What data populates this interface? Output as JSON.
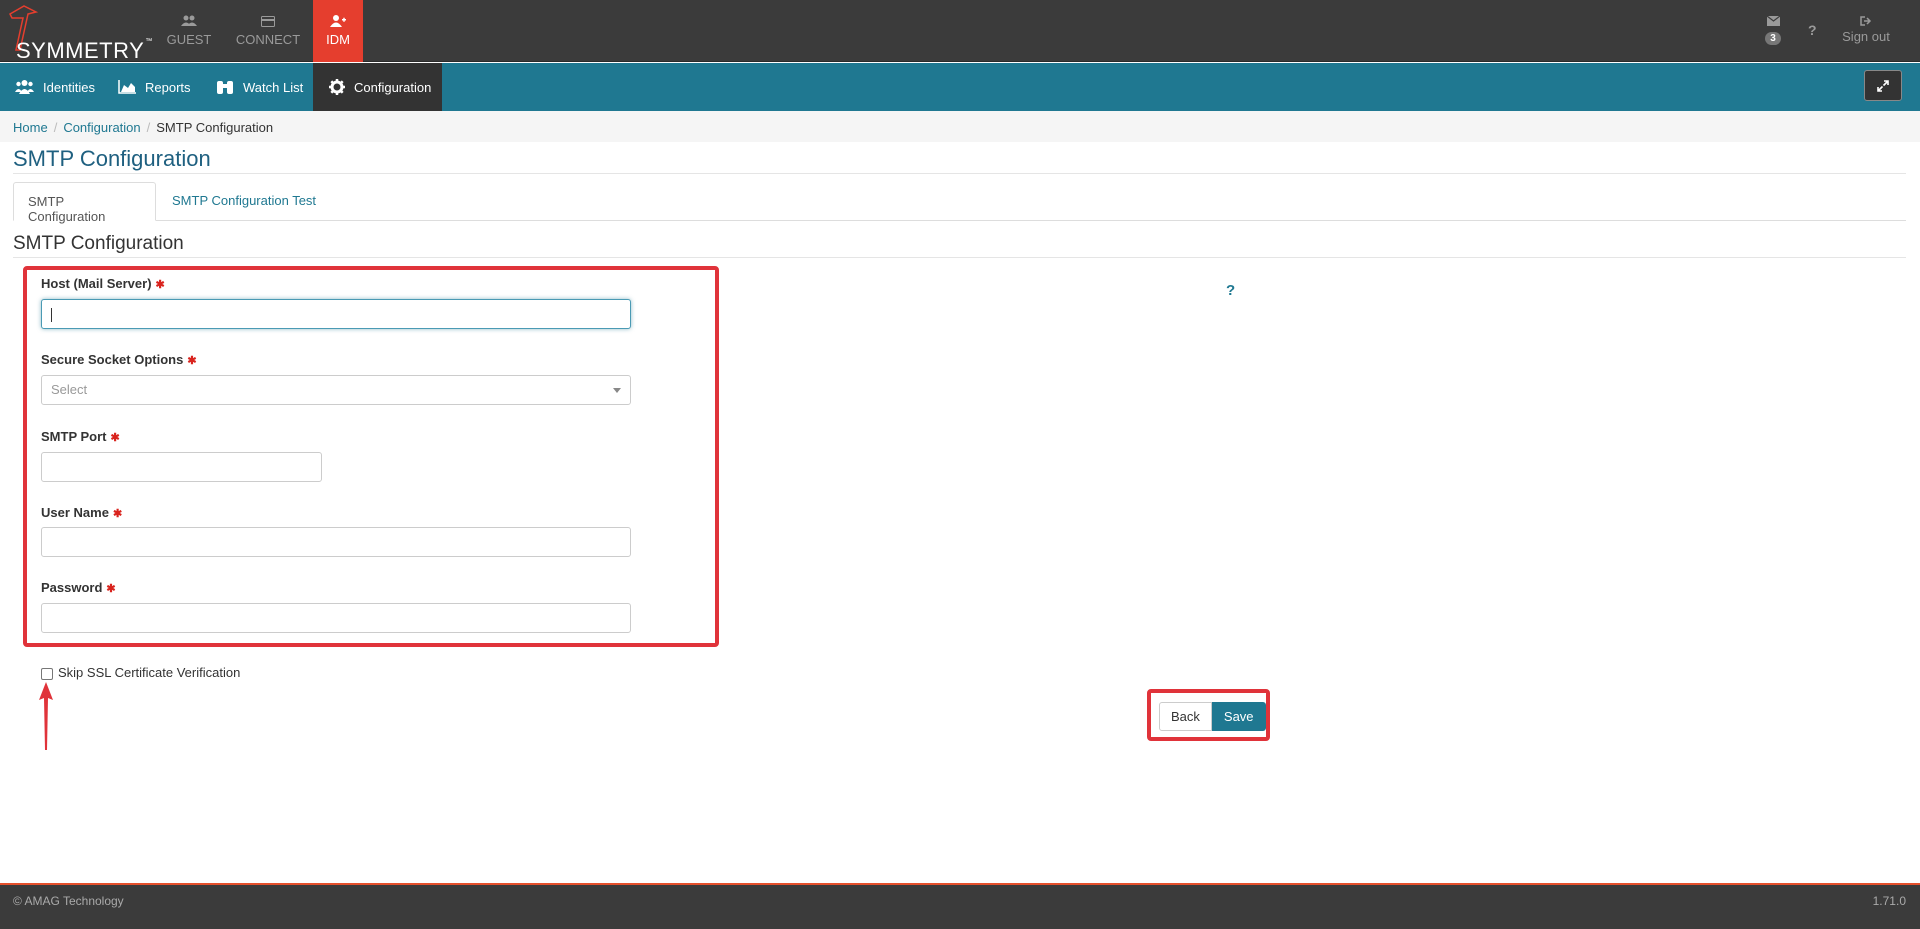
{
  "app": {
    "logo_text": "SYMMETRY",
    "logo_tm": "™",
    "app_tabs": [
      {
        "label": "GUEST",
        "icon": "users-icon"
      },
      {
        "label": "CONNECT",
        "icon": "card-icon"
      },
      {
        "label": "IDM",
        "icon": "user-plus-icon",
        "active": true
      }
    ],
    "mail_count": "3",
    "help_label": "?",
    "signout_label": "Sign out"
  },
  "nav": {
    "items": [
      {
        "label": "Identities",
        "icon": "users-icon"
      },
      {
        "label": "Reports",
        "icon": "area-chart-icon"
      },
      {
        "label": "Watch List",
        "icon": "binoculars-icon"
      },
      {
        "label": "Configuration",
        "icon": "gear-icon",
        "active": true
      }
    ]
  },
  "breadcrumb": {
    "items": [
      "Home",
      "Configuration",
      "SMTP Configuration"
    ],
    "separator": "/"
  },
  "page": {
    "title": "SMTP Configuration",
    "tabs": [
      "SMTP Configuration",
      "SMTP Configuration Test"
    ],
    "section_title": "SMTP Configuration",
    "help_icon": "?"
  },
  "form": {
    "host_label": "Host (Mail Server)",
    "host_value": "",
    "socket_label": "Secure Socket Options",
    "socket_placeholder": "Select",
    "port_label": "SMTP Port",
    "port_value": "",
    "username_label": "User Name",
    "username_value": "",
    "password_label": "Password",
    "password_value": "",
    "required_marker": "✱",
    "skip_ssl_label": "Skip SSL Certificate Verification"
  },
  "buttons": {
    "back": "Back",
    "save": "Save"
  },
  "footer": {
    "copyright": "© AMAG Technology",
    "version": "1.71.0"
  },
  "colors": {
    "accent": "#1f7891",
    "brand_red": "#e53e2e",
    "highlight": "#e0333a",
    "topbar": "#3b3b3b"
  }
}
